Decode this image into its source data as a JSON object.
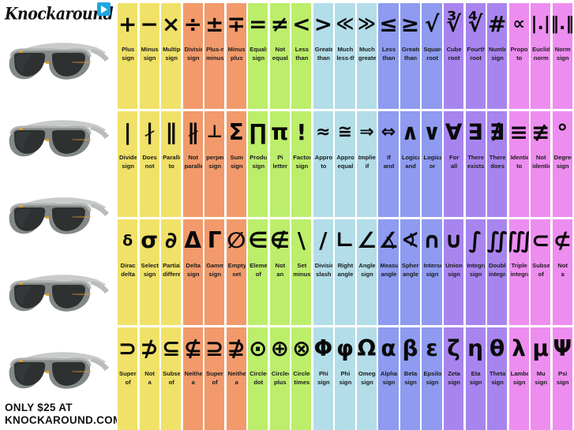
{
  "brand": {
    "wordmark": "Knockaround",
    "badge_icon": "play-badge-icon",
    "promo_line1": "ONLY $25 AT",
    "promo_line2": "KNOCKAROUND.COM",
    "product_image_alt": "sunglasses"
  },
  "palette": {
    "yellow": "#F0E168",
    "orange": "#F29A6B",
    "green": "#BCEE6B",
    "lightblue": "#B3DDE8",
    "periwinkle": "#8E9BF0",
    "purple": "#A885EE",
    "magenta": "#EE8DF0",
    "text": "#111111",
    "background": "#FFFFFF",
    "badge": "#1EA6E0"
  },
  "grid": {
    "columns": 21,
    "rows": 4,
    "group_colors": [
      "yellow",
      "orange",
      "green",
      "lightblue",
      "periwinkle",
      "purple",
      "magenta"
    ],
    "cells": [
      [
        {
          "symbol": "+",
          "l1": "Plus",
          "l2": "sign",
          "size": "lg"
        },
        {
          "symbol": "−",
          "l1": "Minus",
          "l2": "sign",
          "size": "lg"
        },
        {
          "symbol": "×",
          "l1": "Multiplication",
          "l2": "sign",
          "size": "lg"
        },
        {
          "symbol": "÷",
          "l1": "Division",
          "l2": "sign",
          "size": "lg"
        },
        {
          "symbol": "±",
          "l1": "Plus-minus",
          "l2": "minus",
          "size": "lg"
        },
        {
          "symbol": "∓",
          "l1": "Minus-",
          "l2": "plus",
          "size": "lg"
        },
        {
          "symbol": "=",
          "l1": "Equals",
          "l2": "sign",
          "size": "lg"
        },
        {
          "symbol": "≠",
          "l1": "Not",
          "l2": "equal",
          "size": "lg"
        },
        {
          "symbol": "<",
          "l1": "Less",
          "l2": "than",
          "size": "lg"
        },
        {
          "symbol": ">",
          "l1": "Greater",
          "l2": "than",
          "size": "lg"
        },
        {
          "symbol": "≪",
          "l1": "Much",
          "l2": "less-than",
          "size": "md"
        },
        {
          "symbol": "≫",
          "l1": "Much",
          "l2": "greater",
          "size": "md"
        },
        {
          "symbol": "≤",
          "l1": "Less",
          "l2": "than",
          "size": "lg"
        },
        {
          "symbol": "≥",
          "l1": "Greater",
          "l2": "than",
          "size": "lg"
        },
        {
          "symbol": "√",
          "l1": "Square",
          "l2": "root",
          "size": "lg"
        },
        {
          "symbol": "∛",
          "l1": "Cube",
          "l2": "root",
          "size": "lg"
        },
        {
          "symbol": "∜",
          "l1": "Fourth",
          "l2": "root",
          "size": "lg"
        },
        {
          "symbol": "#",
          "l1": "Number",
          "l2": "sign",
          "size": "lg"
        },
        {
          "symbol": "∝",
          "l1": "Proportional",
          "l2": "to",
          "size": "md"
        },
        {
          "symbol": "|.|",
          "l1": "Euclidean",
          "l2": "norm",
          "size": "md"
        },
        {
          "symbol": "‖.‖",
          "l1": "Norm",
          "l2": "sign",
          "size": "md"
        }
      ],
      [
        {
          "symbol": "|",
          "l1": "Divides",
          "l2": "sign",
          "size": "lg"
        },
        {
          "symbol": "∤",
          "l1": "Does",
          "l2": "not",
          "size": "lg"
        },
        {
          "symbol": "∥",
          "l1": "Parallel",
          "l2": "to",
          "size": "lg"
        },
        {
          "symbol": "∦",
          "l1": "Not",
          "l2": "parallel",
          "size": "lg"
        },
        {
          "symbol": "⊥",
          "l1": "perpendicular",
          "l2": "sign",
          "size": "md"
        },
        {
          "symbol": "Σ",
          "l1": "Sum",
          "l2": "sign",
          "size": "lg"
        },
        {
          "symbol": "∏",
          "l1": "Product",
          "l2": "sign",
          "size": "lg"
        },
        {
          "symbol": "π",
          "l1": "Pi",
          "l2": "letter",
          "size": "lg"
        },
        {
          "symbol": "!",
          "l1": "Factorial",
          "l2": "sign",
          "size": "lg"
        },
        {
          "symbol": "≈",
          "l1": "Approximately",
          "l2": "to",
          "size": "md"
        },
        {
          "symbol": "≅",
          "l1": "Approximately",
          "l2": "equal",
          "size": "md"
        },
        {
          "symbol": "⇒",
          "l1": "Implies",
          "l2": "if",
          "size": "md"
        },
        {
          "symbol": "⇔",
          "l1": "If",
          "l2": "and",
          "size": "md"
        },
        {
          "symbol": "∧",
          "l1": "Logical",
          "l2": "and",
          "size": "lg"
        },
        {
          "symbol": "∨",
          "l1": "Logical",
          "l2": "or",
          "size": "lg"
        },
        {
          "symbol": "∀",
          "l1": "For",
          "l2": "all",
          "size": "lg"
        },
        {
          "symbol": "∃",
          "l1": "There",
          "l2": "exists",
          "size": "lg"
        },
        {
          "symbol": "∄",
          "l1": "There",
          "l2": "does",
          "size": "lg"
        },
        {
          "symbol": "≡",
          "l1": "Identical",
          "l2": "to",
          "size": "lg"
        },
        {
          "symbol": "≢",
          "l1": "Not",
          "l2": "identical",
          "size": "lg"
        },
        {
          "symbol": "°",
          "l1": "Degree",
          "l2": "sign",
          "size": "lg"
        }
      ],
      [
        {
          "symbol": "δ",
          "l1": "Dirac",
          "l2": "delta",
          "size": "sm"
        },
        {
          "symbol": "σ",
          "l1": "Selection",
          "l2": "sign",
          "size": "lg"
        },
        {
          "symbol": "∂",
          "l1": "Partial",
          "l2": "differential",
          "size": "lg"
        },
        {
          "symbol": "Δ",
          "l1": "Delta",
          "l2": "sign",
          "size": "lg"
        },
        {
          "symbol": "Γ",
          "l1": "Gamma",
          "l2": "sign",
          "size": "lg"
        },
        {
          "symbol": "∅",
          "l1": "Empty",
          "l2": "set",
          "size": "lg"
        },
        {
          "symbol": "∈",
          "l1": "Element",
          "l2": "of",
          "size": "lg"
        },
        {
          "symbol": "∉",
          "l1": "Not",
          "l2": "an",
          "size": "lg"
        },
        {
          "symbol": "\\",
          "l1": "Set",
          "l2": "minus",
          "size": "lg"
        },
        {
          "symbol": "/",
          "l1": "Division",
          "l2": "slash",
          "size": "lg"
        },
        {
          "symbol": "∟",
          "l1": "Right",
          "l2": "angle",
          "size": "lg"
        },
        {
          "symbol": "∠",
          "l1": "Angle",
          "l2": "sign",
          "size": "lg"
        },
        {
          "symbol": "∡",
          "l1": "Measured",
          "l2": "angle",
          "size": "lg"
        },
        {
          "symbol": "∢",
          "l1": "Spherical",
          "l2": "angle",
          "size": "lg"
        },
        {
          "symbol": "∩",
          "l1": "Intersection",
          "l2": "sign",
          "size": "lg"
        },
        {
          "symbol": "∪",
          "l1": "Union",
          "l2": "sign",
          "size": "lg"
        },
        {
          "symbol": "∫",
          "l1": "Integral",
          "l2": "sign",
          "size": "lg"
        },
        {
          "symbol": "∬",
          "l1": "Double",
          "l2": "integral",
          "size": "lg"
        },
        {
          "symbol": "∭",
          "l1": "Triple",
          "l2": "integral",
          "size": "lg"
        },
        {
          "symbol": "⊂",
          "l1": "Subset",
          "l2": "of",
          "size": "lg"
        },
        {
          "symbol": "⊄",
          "l1": "Not",
          "l2": "a",
          "size": "lg"
        }
      ],
      [
        {
          "symbol": "⊃",
          "l1": "Superset",
          "l2": "of",
          "size": "lg"
        },
        {
          "symbol": "⊅",
          "l1": "Not",
          "l2": "a",
          "size": "lg"
        },
        {
          "symbol": "⊆",
          "l1": "Subset",
          "l2": "of",
          "size": "lg"
        },
        {
          "symbol": "⊈",
          "l1": "Neither",
          "l2": "a",
          "size": "lg"
        },
        {
          "symbol": "⊇",
          "l1": "Superset",
          "l2": "of",
          "size": "lg"
        },
        {
          "symbol": "⊉",
          "l1": "Neither",
          "l2": "a",
          "size": "lg"
        },
        {
          "symbol": "⊙",
          "l1": "Circled",
          "l2": "dot",
          "size": "lg"
        },
        {
          "symbol": "⊕",
          "l1": "Circled",
          "l2": "plus",
          "size": "lg"
        },
        {
          "symbol": "⊗",
          "l1": "Circled",
          "l2": "times",
          "size": "lg"
        },
        {
          "symbol": "Φ",
          "l1": "Phi",
          "l2": "sign",
          "size": "lg"
        },
        {
          "symbol": "φ",
          "l1": "Phi",
          "l2": "sign",
          "size": "lg"
        },
        {
          "symbol": "Ω",
          "l1": "Omega",
          "l2": "sign",
          "size": "lg"
        },
        {
          "symbol": "α",
          "l1": "Alpha",
          "l2": "sign",
          "size": "lg"
        },
        {
          "symbol": "β",
          "l1": "Beta",
          "l2": "sign",
          "size": "lg"
        },
        {
          "symbol": "ε",
          "l1": "Epsilon",
          "l2": "sign",
          "size": "lg"
        },
        {
          "symbol": "ζ",
          "l1": "Zeta",
          "l2": "sign",
          "size": "lg"
        },
        {
          "symbol": "η",
          "l1": "Eta",
          "l2": "sign",
          "size": "lg"
        },
        {
          "symbol": "θ",
          "l1": "Theta",
          "l2": "sign",
          "size": "lg"
        },
        {
          "symbol": "λ",
          "l1": "Lambda",
          "l2": "sign",
          "size": "lg"
        },
        {
          "symbol": "μ",
          "l1": "Mu",
          "l2": "sign",
          "size": "lg"
        },
        {
          "symbol": "Ψ",
          "l1": "Psi",
          "l2": "sign",
          "size": "lg"
        }
      ]
    ]
  }
}
